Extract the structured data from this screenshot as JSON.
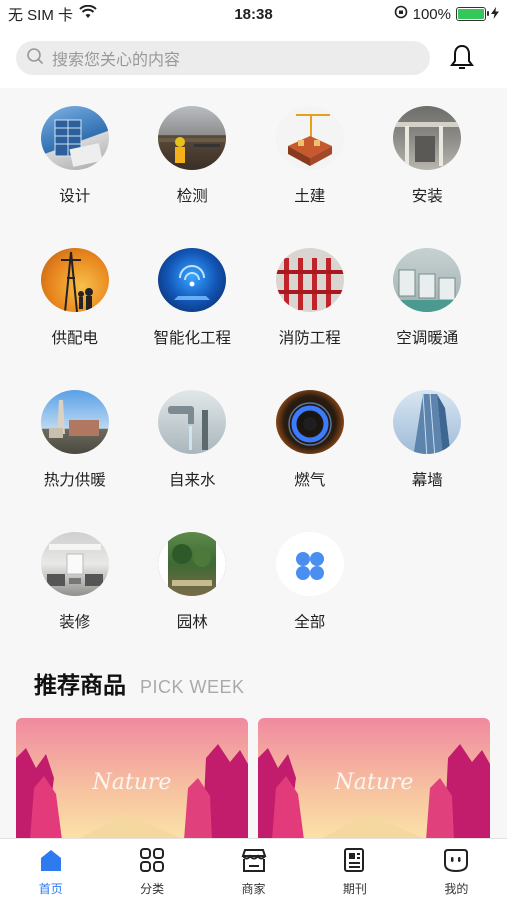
{
  "status_bar": {
    "carrier": "无 SIM 卡",
    "time": "18:38",
    "battery": "100%"
  },
  "search": {
    "placeholder": "搜索您关心的内容"
  },
  "categories": [
    {
      "label": "设计",
      "icon": "design-building-icon"
    },
    {
      "label": "检测",
      "icon": "inspection-worker-icon"
    },
    {
      "label": "土建",
      "icon": "construction-crane-icon"
    },
    {
      "label": "安装",
      "icon": "installation-pipes-icon"
    },
    {
      "label": "供配电",
      "icon": "power-tower-icon"
    },
    {
      "label": "智能化工程",
      "icon": "smart-tech-icon"
    },
    {
      "label": "消防工程",
      "icon": "fire-pipes-icon"
    },
    {
      "label": "空调暖通",
      "icon": "hvac-units-icon"
    },
    {
      "label": "热力供暖",
      "icon": "heating-station-icon"
    },
    {
      "label": "自来水",
      "icon": "water-tap-icon"
    },
    {
      "label": "燃气",
      "icon": "gas-flame-icon"
    },
    {
      "label": "幕墙",
      "icon": "curtain-wall-icon"
    },
    {
      "label": "装修",
      "icon": "decoration-room-icon"
    },
    {
      "label": "园林",
      "icon": "garden-icon"
    },
    {
      "label": "全部",
      "icon": "all-grid-icon"
    }
  ],
  "section": {
    "title": "推荐商品",
    "subtitle": "PICK WEEK"
  },
  "products": [
    {
      "image_text": "Nature"
    },
    {
      "image_text": "Nature"
    }
  ],
  "tabs": [
    {
      "label": "首页",
      "icon": "home-icon",
      "active": true
    },
    {
      "label": "分类",
      "icon": "category-grid-icon",
      "active": false
    },
    {
      "label": "商家",
      "icon": "store-icon",
      "active": false
    },
    {
      "label": "期刊",
      "icon": "newspaper-icon",
      "active": false
    },
    {
      "label": "我的",
      "icon": "profile-icon",
      "active": false
    }
  ],
  "colors": {
    "accent": "#2e7bf0",
    "battery": "#34c759"
  }
}
